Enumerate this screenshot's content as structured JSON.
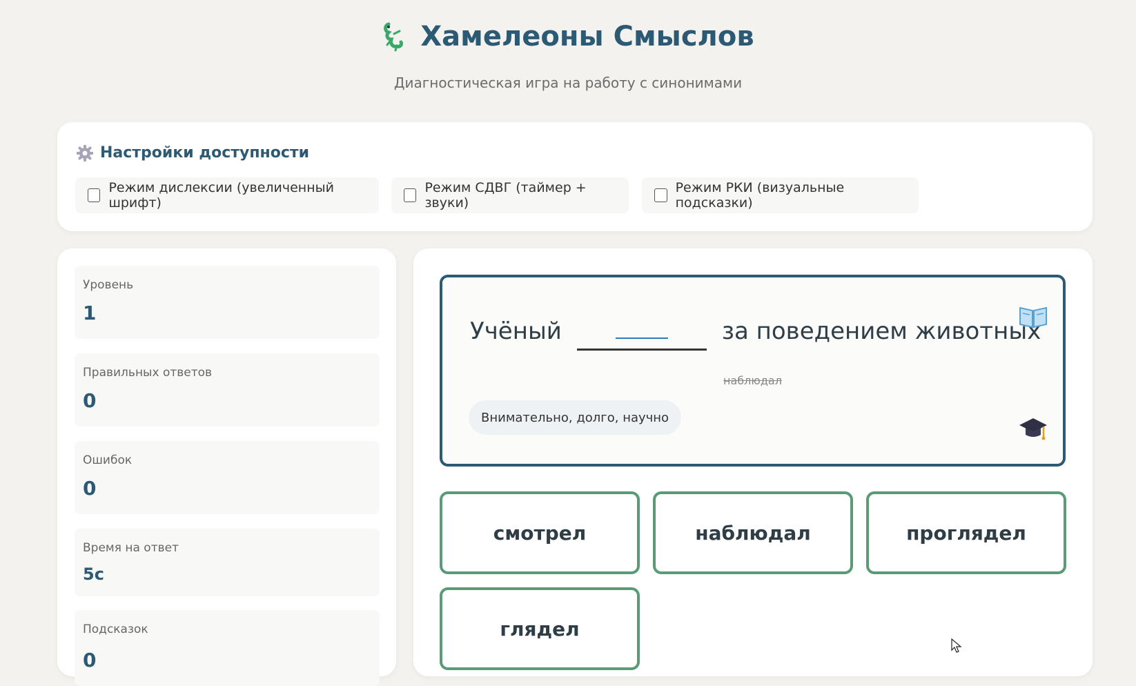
{
  "header": {
    "logo_icon": "lizard-icon",
    "title": "Хамелеоны Смыслов",
    "subtitle": "Диагностическая игра на работу с синонимами"
  },
  "settings": {
    "icon": "gear-icon",
    "title": "Настройки доступности",
    "options": [
      {
        "label": "Режим дислексии (увеличенный шрифт)",
        "checked": false
      },
      {
        "label": "Режим СДВГ (таймер + звуки)",
        "checked": false
      },
      {
        "label": "Режим РКИ (визуальные подсказки)",
        "checked": false
      }
    ]
  },
  "stats": [
    {
      "label": "Уровень",
      "value": "1"
    },
    {
      "label": "Правильных ответов",
      "value": "0"
    },
    {
      "label": "Ошибок",
      "value": "0"
    },
    {
      "label": "Время на ответ",
      "value": "5с"
    },
    {
      "label": "Подсказок",
      "value": "0"
    }
  ],
  "question": {
    "before": "Учёный",
    "after": "за поведением животных",
    "crossed_word": "наблюдал",
    "hint": "Внимательно, долго, научно",
    "book_icon": "book-icon",
    "cap_icon": "graduation-cap-icon"
  },
  "choices": [
    "смотрел",
    "наблюдал",
    "проглядел",
    "глядел"
  ]
}
